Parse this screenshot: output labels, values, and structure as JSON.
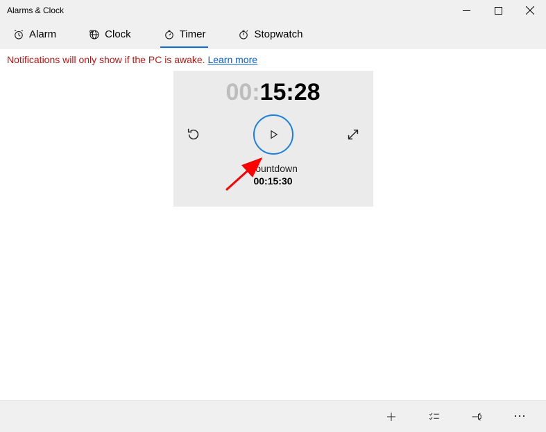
{
  "window": {
    "title": "Alarms & Clock"
  },
  "tabs": {
    "alarm": {
      "label": "Alarm"
    },
    "clock": {
      "label": "Clock"
    },
    "timer": {
      "label": "Timer"
    },
    "stopwatch": {
      "label": "Stopwatch"
    }
  },
  "notice": {
    "text": "Notifications will only show if the PC is awake. ",
    "link_label": "Learn more"
  },
  "timer": {
    "hh": "00",
    "mmss": "15:28",
    "name": "Countdown",
    "set_value": "00:15:30"
  }
}
